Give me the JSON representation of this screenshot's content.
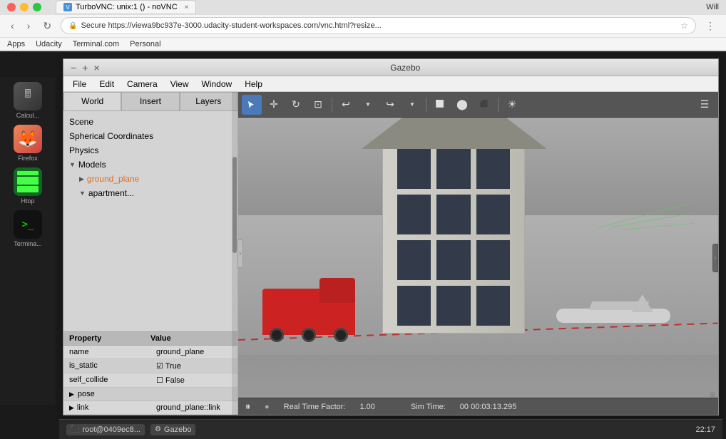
{
  "browser": {
    "title": "TurboVNC: unix:1 () - noVNC",
    "tab_label": "TurboVNC: unix:1 () - noVNC",
    "address": "https://viewa9bc937e-3000.udacity-student-workspaces.com/vnc.html?resize...",
    "address_short": "Secure  https://viewa9bc937e-3000.udacity-student-workspaces.com/vnc.html?resize...",
    "user": "Will",
    "bookmarks": [
      "Apps",
      "Udacity",
      "Terminal.com",
      "Personal"
    ]
  },
  "gazebo": {
    "title": "Gazebo",
    "menu_items": [
      "File",
      "Edit",
      "Camera",
      "View",
      "Window",
      "Help"
    ],
    "minimize_label": "−",
    "maximize_label": "+",
    "close_label": "×"
  },
  "panel": {
    "tabs": [
      "World",
      "Insert",
      "Layers"
    ],
    "active_tab": "World",
    "tree_items": [
      {
        "label": "Scene",
        "level": 0,
        "has_arrow": false
      },
      {
        "label": "Spherical Coordinates",
        "level": 0,
        "has_arrow": false
      },
      {
        "label": "Physics",
        "level": 0,
        "has_arrow": false
      },
      {
        "label": "Models",
        "level": 0,
        "has_arrow": true,
        "expanded": true
      },
      {
        "label": "ground_plane",
        "level": 1,
        "has_arrow": true,
        "color": "orange"
      },
      {
        "label": "apartment...",
        "level": 1,
        "has_arrow": true,
        "expanded": true
      }
    ]
  },
  "properties": {
    "header_property": "Property",
    "header_value": "Value",
    "rows": [
      {
        "name": "name",
        "value": "ground_plane"
      },
      {
        "name": "is_static",
        "value": "✓ True"
      },
      {
        "name": "self_collide",
        "value": "□ False"
      }
    ],
    "sections": [
      {
        "label": "pose"
      },
      {
        "label": "link",
        "value": "ground_plane::link"
      }
    ]
  },
  "toolbar": {
    "tools": [
      "cursor",
      "move",
      "rotate",
      "scale-screen",
      "undo",
      "sep",
      "redo",
      "sep2",
      "box",
      "sphere",
      "cylinder",
      "sun",
      "sep3",
      "settings"
    ]
  },
  "status_bar": {
    "play_icon": "⏸",
    "dot_icon": "●",
    "real_time_label": "Real Time Factor:",
    "real_time_value": "1.00",
    "sim_time_label": "Sim Time:",
    "sim_time_value": "00 00:03:13.295"
  },
  "sidebar": {
    "icons": [
      {
        "label": "Calcul...",
        "icon": "🖩",
        "bg": "#444"
      },
      {
        "label": "Firefox",
        "icon": "🦊",
        "bg": "#c54"
      },
      {
        "label": "Htop",
        "icon": "📊",
        "bg": "#162"
      },
      {
        "label": "Termina...",
        "icon": ">_",
        "bg": "#111"
      }
    ]
  },
  "taskbar": {
    "apps": [
      {
        "label": "root@0409ec8..."
      },
      {
        "label": "Gazebo"
      }
    ],
    "time": "22:17"
  }
}
